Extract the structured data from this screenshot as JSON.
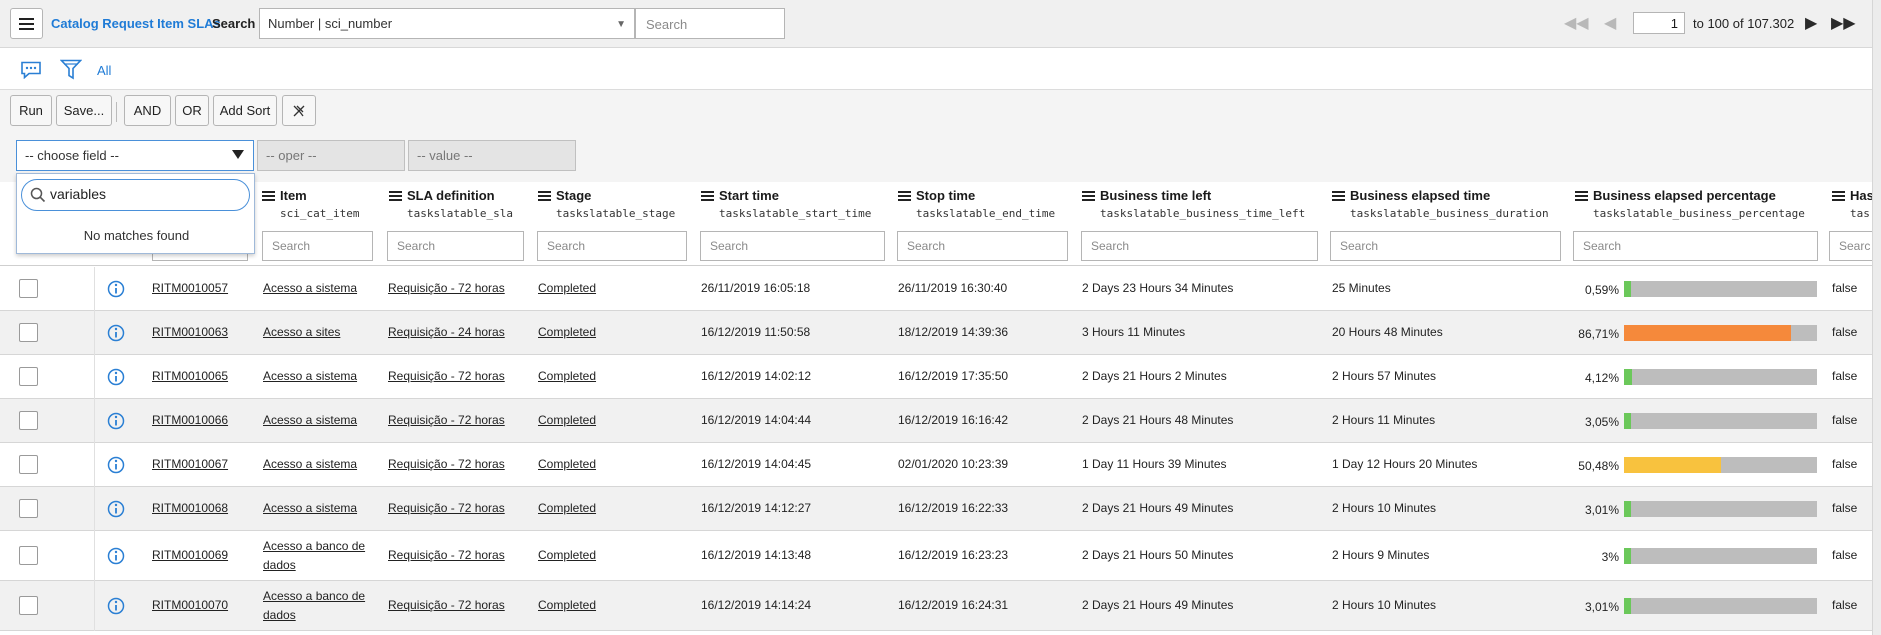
{
  "header": {
    "list_title": "Catalog Request Item SLAs",
    "search_label": "Search",
    "search_field_value": "Number | sci_number",
    "search_placeholder": "Search",
    "page_input": "1",
    "page_range_text": "to 100 of 107.302"
  },
  "filter": {
    "breadcrumb_all": "All"
  },
  "condition_builder": {
    "buttons": {
      "run": "Run",
      "save": "Save...",
      "and": "AND",
      "or": "OR",
      "add_sort": "Add Sort"
    },
    "choose_field": "-- choose field --",
    "operator": "-- oper --",
    "value": "-- value --",
    "dropdown": {
      "search_value": "variables",
      "message": "No matches found"
    }
  },
  "table": {
    "columns": [
      {
        "label": "Item",
        "field": "sci_cat_item"
      },
      {
        "label": "SLA definition",
        "field": "taskslatable_sla"
      },
      {
        "label": "Stage",
        "field": "taskslatable_stage"
      },
      {
        "label": "Start time",
        "field": "taskslatable_start_time"
      },
      {
        "label": "Stop time",
        "field": "taskslatable_end_time"
      },
      {
        "label": "Business time left",
        "field": "taskslatable_business_time_left"
      },
      {
        "label": "Business elapsed time",
        "field": "taskslatable_business_duration"
      },
      {
        "label": "Business elapsed percentage",
        "field": "taskslatable_business_percentage"
      },
      {
        "label": "Has",
        "field": "tas"
      }
    ],
    "search_placeholder": "Search",
    "partial_search_placeholder": "Searc",
    "rows": [
      {
        "number": "RITM0010057",
        "item": "Acesso a sistema",
        "item2": "",
        "sla": "Requisição - 72 horas",
        "stage": "Completed",
        "start": "26/11/2019 16:05:18",
        "stop": "26/11/2019 16:30:40",
        "time_left": "2 Days 23 Hours 34 Minutes",
        "elapsed": "25 Minutes",
        "pct_label": "0,59%",
        "pct": 0.59,
        "bar_color": "#6bc85a",
        "has": "false"
      },
      {
        "number": "RITM0010063",
        "item": "Acesso a sites",
        "item2": "",
        "sla": "Requisição - 24 horas",
        "stage": "Completed",
        "start": "16/12/2019 11:50:58",
        "stop": "18/12/2019 14:39:36",
        "time_left": "3 Hours 11 Minutes",
        "elapsed": "20 Hours 48 Minutes",
        "pct_label": "86,71%",
        "pct": 86.71,
        "bar_color": "#f5893b",
        "has": "false"
      },
      {
        "number": "RITM0010065",
        "item": "Acesso a sistema",
        "item2": "",
        "sla": "Requisição - 72 horas",
        "stage": "Completed",
        "start": "16/12/2019 14:02:12",
        "stop": "16/12/2019 17:35:50",
        "time_left": "2 Days 21 Hours 2 Minutes",
        "elapsed": "2 Hours 57 Minutes",
        "pct_label": "4,12%",
        "pct": 4.12,
        "bar_color": "#6bc85a",
        "has": "false"
      },
      {
        "number": "RITM0010066",
        "item": "Acesso a sistema",
        "item2": "",
        "sla": "Requisição - 72 horas",
        "stage": "Completed",
        "start": "16/12/2019 14:04:44",
        "stop": "16/12/2019 16:16:42",
        "time_left": "2 Days 21 Hours 48 Minutes",
        "elapsed": "2 Hours 11 Minutes",
        "pct_label": "3,05%",
        "pct": 3.05,
        "bar_color": "#6bc85a",
        "has": "false"
      },
      {
        "number": "RITM0010067",
        "item": "Acesso a sistema",
        "item2": "",
        "sla": "Requisição - 72 horas",
        "stage": "Completed",
        "start": "16/12/2019 14:04:45",
        "stop": "02/01/2020 10:23:39",
        "time_left": "1 Day 11 Hours 39 Minutes",
        "elapsed": "1 Day 12 Hours 20 Minutes",
        "pct_label": "50,48%",
        "pct": 50.48,
        "bar_color": "#f8c23e",
        "has": "false"
      },
      {
        "number": "RITM0010068",
        "item": "Acesso a sistema",
        "item2": "",
        "sla": "Requisição - 72 horas",
        "stage": "Completed",
        "start": "16/12/2019 14:12:27",
        "stop": "16/12/2019 16:22:33",
        "time_left": "2 Days 21 Hours 49 Minutes",
        "elapsed": "2 Hours 10 Minutes",
        "pct_label": "3,01%",
        "pct": 3.01,
        "bar_color": "#6bc85a",
        "has": "false"
      },
      {
        "number": "RITM0010069",
        "item": "Acesso a banco de",
        "item2": "dados",
        "sla": "Requisição - 72 horas",
        "stage": "Completed",
        "start": "16/12/2019 14:13:48",
        "stop": "16/12/2019 16:23:23",
        "time_left": "2 Days 21 Hours 50 Minutes",
        "elapsed": "2 Hours 9 Minutes",
        "pct_label": "3%",
        "pct": 3,
        "bar_color": "#6bc85a",
        "has": "false"
      },
      {
        "number": "RITM0010070",
        "item": "Acesso a banco de",
        "item2": "dados",
        "sla": "Requisição - 72 horas",
        "stage": "Completed",
        "start": "16/12/2019 14:14:24",
        "stop": "16/12/2019 16:24:31",
        "time_left": "2 Days 21 Hours 49 Minutes",
        "elapsed": "2 Hours 10 Minutes",
        "pct_label": "3,01%",
        "pct": 3.01,
        "bar_color": "#6bc85a",
        "has": "false"
      }
    ]
  }
}
